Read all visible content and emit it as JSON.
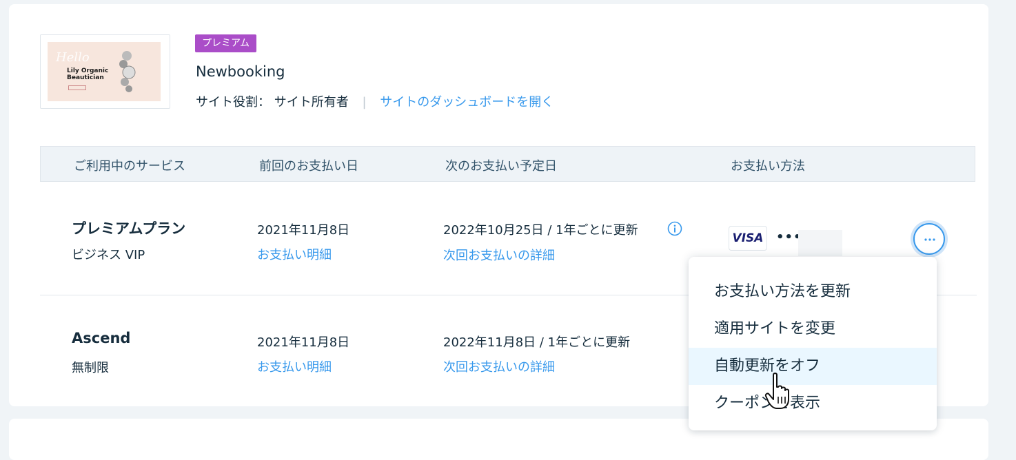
{
  "site": {
    "badge": "プレミアム",
    "name": "Newbooking",
    "role_label": "サイト役割：",
    "role_value": "サイト所有者",
    "dashboard_link": "サイトのダッシュボードを開く",
    "thumbnail": {
      "script_text": "Hello",
      "title_line1": "Lily Organic",
      "title_line2": "Beautician"
    }
  },
  "table": {
    "headers": [
      "ご利用中のサービス",
      "前回のお支払い日",
      "次のお支払い予定日",
      "お支払い方法"
    ],
    "rows": [
      {
        "service_name": "プレミアムプラン",
        "service_sub": "ビジネス VIP",
        "last_payment_date": "2021年11月8日",
        "last_payment_link": "お支払い明細",
        "next_payment": "2022年10月25日 / 1年ごとに更新",
        "next_payment_link": "次回お支払いの詳細",
        "card_brand": "VISA",
        "card_masked": "••••"
      },
      {
        "service_name": "Ascend",
        "service_sub": "無制限",
        "last_payment_date": "2021年11月8日",
        "last_payment_link": "お支払い明細",
        "next_payment": "2022年11月8日 / 1年ごとに更新",
        "next_payment_link": "次回お支払いの詳細"
      }
    ]
  },
  "menu": {
    "items": [
      "お支払い方法を更新",
      "適用サイトを変更",
      "自動更新をオフ",
      "クーポンを表示"
    ],
    "hovered_index": 2
  },
  "colors": {
    "accent": "#3899ec",
    "badge": "#aa4dc8",
    "text": "#162d3d",
    "hover": "#eaf7ff"
  },
  "icons": [
    "info-icon",
    "more-options-icon",
    "pointer-cursor-icon",
    "visa-logo"
  ]
}
